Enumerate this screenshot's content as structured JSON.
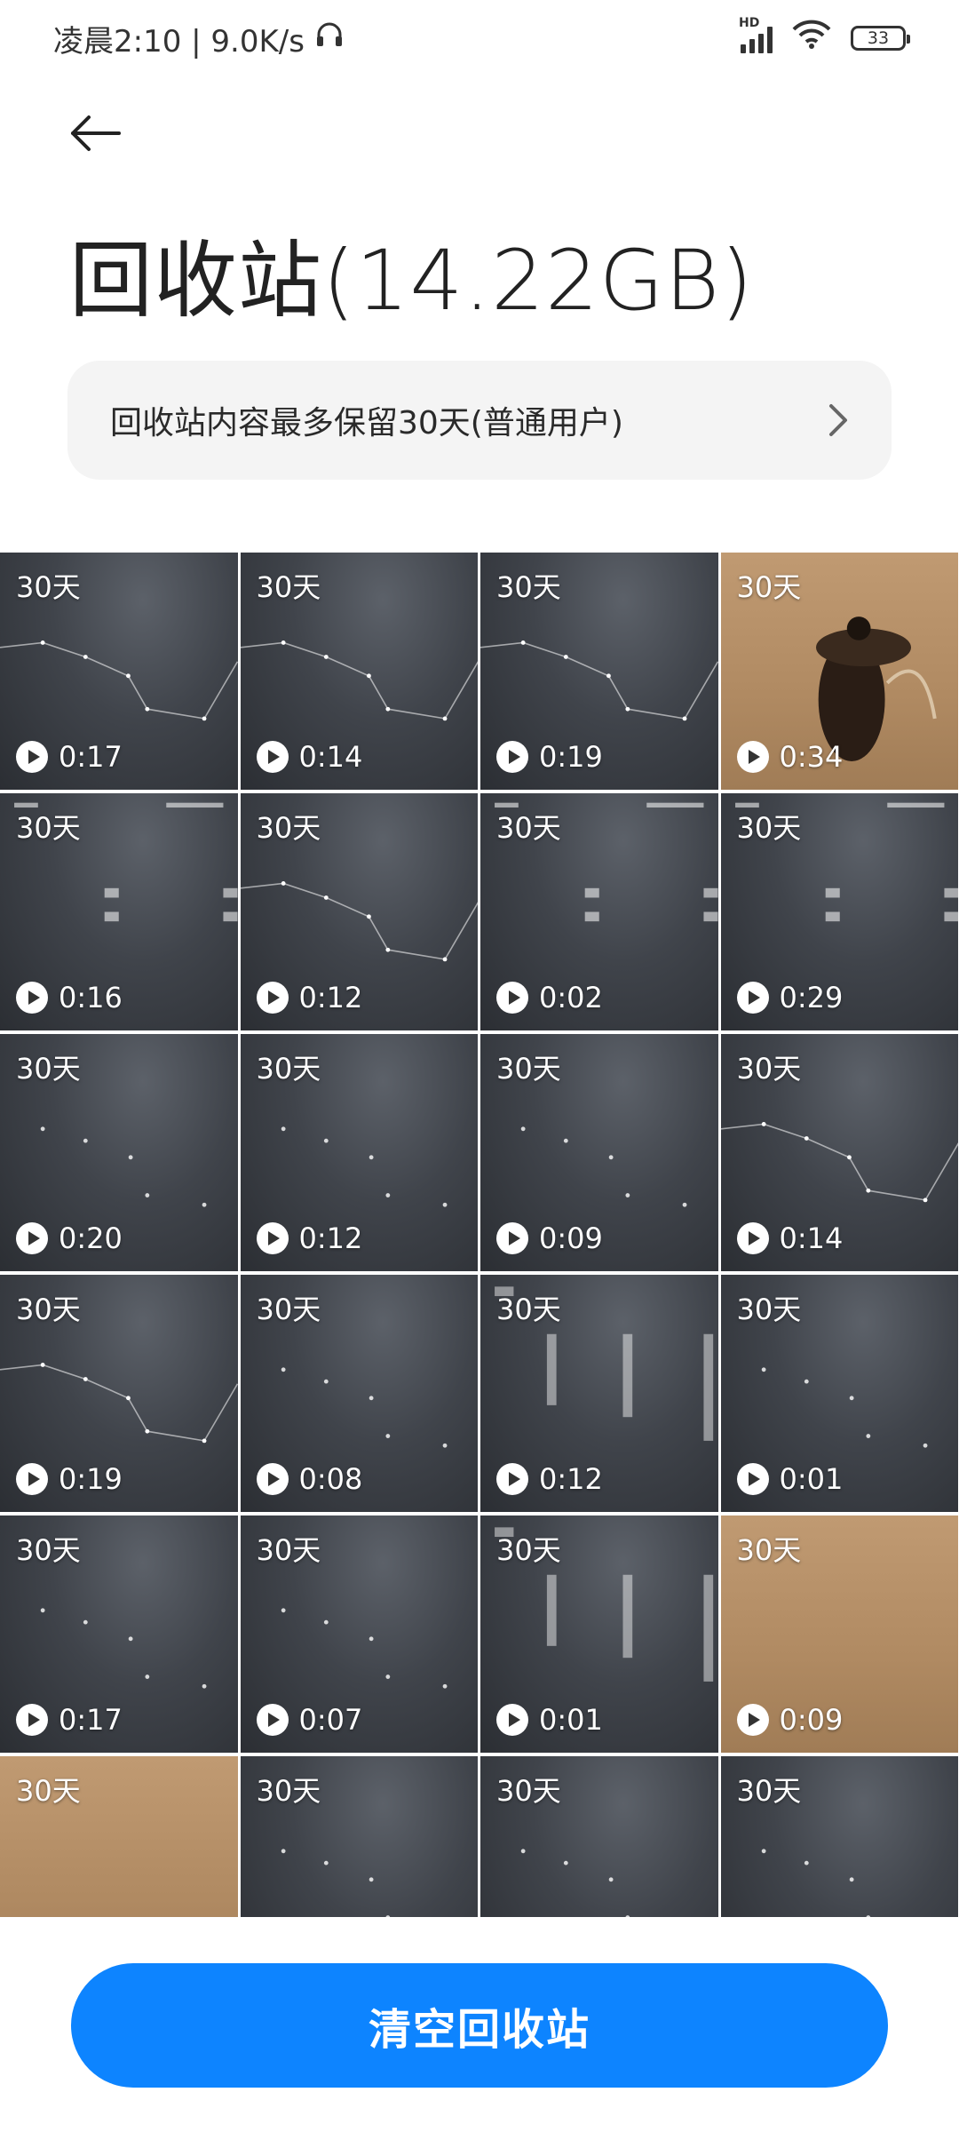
{
  "status_bar": {
    "time_speed": "凌晨2:10 | 9.0K/s",
    "network_label": "HD",
    "battery": "33",
    "icons": [
      "headphones-icon",
      "signal-icon",
      "wifi-icon",
      "battery-icon"
    ]
  },
  "header": {
    "title": "回收站(14.22GB)"
  },
  "notice": {
    "text": "回收站内容最多保留30天(普通用户)"
  },
  "grid": {
    "items": [
      {
        "retention": "30天",
        "duration": "0:17",
        "kind": "dark",
        "deco": "line"
      },
      {
        "retention": "30天",
        "duration": "0:14",
        "kind": "dark",
        "deco": "line"
      },
      {
        "retention": "30天",
        "duration": "0:19",
        "kind": "dark",
        "deco": "line"
      },
      {
        "retention": "30天",
        "duration": "0:34",
        "kind": "sand",
        "deco": "figure"
      },
      {
        "retention": "30天",
        "duration": "0:16",
        "kind": "dark",
        "deco": "text"
      },
      {
        "retention": "30天",
        "duration": "0:12",
        "kind": "dark",
        "deco": "line"
      },
      {
        "retention": "30天",
        "duration": "0:02",
        "kind": "dark",
        "deco": "text"
      },
      {
        "retention": "30天",
        "duration": "0:29",
        "kind": "dark",
        "deco": "text"
      },
      {
        "retention": "30天",
        "duration": "0:20",
        "kind": "dark",
        "deco": "dots"
      },
      {
        "retention": "30天",
        "duration": "0:12",
        "kind": "dark",
        "deco": "dots"
      },
      {
        "retention": "30天",
        "duration": "0:09",
        "kind": "dark",
        "deco": "dots"
      },
      {
        "retention": "30天",
        "duration": "0:14",
        "kind": "dark",
        "deco": "line"
      },
      {
        "retention": "30天",
        "duration": "0:19",
        "kind": "dark",
        "deco": "line"
      },
      {
        "retention": "30天",
        "duration": "0:08",
        "kind": "dark",
        "deco": "dots"
      },
      {
        "retention": "30天",
        "duration": "0:12",
        "kind": "dark",
        "deco": "blur"
      },
      {
        "retention": "30天",
        "duration": "0:01",
        "kind": "dark",
        "deco": "dots"
      },
      {
        "retention": "30天",
        "duration": "0:17",
        "kind": "dark",
        "deco": "dots"
      },
      {
        "retention": "30天",
        "duration": "0:07",
        "kind": "dark",
        "deco": "dots"
      },
      {
        "retention": "30天",
        "duration": "0:01",
        "kind": "dark",
        "deco": "blur"
      },
      {
        "retention": "30天",
        "duration": "0:09",
        "kind": "sand",
        "deco": "none"
      },
      {
        "retention": "30天",
        "duration": "",
        "kind": "sand",
        "deco": "none"
      },
      {
        "retention": "30天",
        "duration": "",
        "kind": "dark",
        "deco": "dots"
      },
      {
        "retention": "30天",
        "duration": "",
        "kind": "dark",
        "deco": "dots"
      },
      {
        "retention": "30天",
        "duration": "",
        "kind": "dark",
        "deco": "dots"
      }
    ]
  },
  "footer": {
    "clear_button_label": "清空回收站"
  },
  "colors": {
    "accent": "#0d84ff",
    "notice_bg": "#f4f4f4"
  }
}
